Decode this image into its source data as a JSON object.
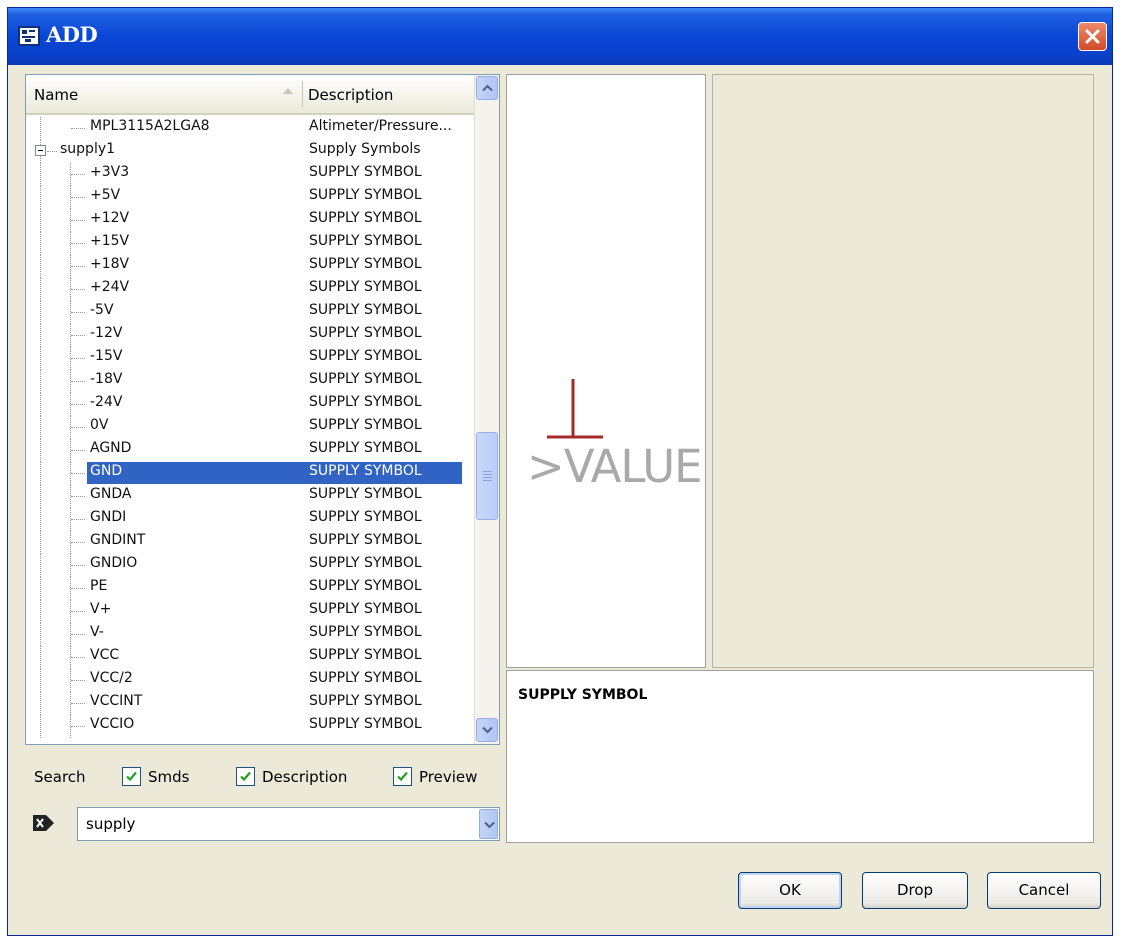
{
  "window": {
    "title": "ADD"
  },
  "tree": {
    "columns": {
      "name": "Name",
      "description": "Description"
    },
    "rows": [
      {
        "name": "MPL3115A2LGA8",
        "description": "Altimeter/Pressure...",
        "level": 2
      },
      {
        "name": "supply1",
        "description": "Supply Symbols",
        "level": 1,
        "expanded": true
      },
      {
        "name": "+3V3",
        "description": "SUPPLY SYMBOL",
        "level": 2
      },
      {
        "name": "+5V",
        "description": "SUPPLY SYMBOL",
        "level": 2
      },
      {
        "name": "+12V",
        "description": "SUPPLY SYMBOL",
        "level": 2
      },
      {
        "name": "+15V",
        "description": "SUPPLY SYMBOL",
        "level": 2
      },
      {
        "name": "+18V",
        "description": "SUPPLY SYMBOL",
        "level": 2
      },
      {
        "name": "+24V",
        "description": "SUPPLY SYMBOL",
        "level": 2
      },
      {
        "name": "-5V",
        "description": "SUPPLY SYMBOL",
        "level": 2
      },
      {
        "name": "-12V",
        "description": "SUPPLY SYMBOL",
        "level": 2
      },
      {
        "name": "-15V",
        "description": "SUPPLY SYMBOL",
        "level": 2
      },
      {
        "name": "-18V",
        "description": "SUPPLY SYMBOL",
        "level": 2
      },
      {
        "name": "-24V",
        "description": "SUPPLY SYMBOL",
        "level": 2
      },
      {
        "name": "0V",
        "description": "SUPPLY SYMBOL",
        "level": 2
      },
      {
        "name": "AGND",
        "description": "SUPPLY SYMBOL",
        "level": 2
      },
      {
        "name": "GND",
        "description": "SUPPLY SYMBOL",
        "level": 2,
        "selected": true
      },
      {
        "name": "GNDA",
        "description": "SUPPLY SYMBOL",
        "level": 2
      },
      {
        "name": "GNDI",
        "description": "SUPPLY SYMBOL",
        "level": 2
      },
      {
        "name": "GNDINT",
        "description": "SUPPLY SYMBOL",
        "level": 2
      },
      {
        "name": "GNDIO",
        "description": "SUPPLY SYMBOL",
        "level": 2
      },
      {
        "name": "PE",
        "description": "SUPPLY SYMBOL",
        "level": 2
      },
      {
        "name": "V+",
        "description": "SUPPLY SYMBOL",
        "level": 2
      },
      {
        "name": "V-",
        "description": "SUPPLY SYMBOL",
        "level": 2
      },
      {
        "name": "VCC",
        "description": "SUPPLY SYMBOL",
        "level": 2
      },
      {
        "name": "VCC/2",
        "description": "SUPPLY SYMBOL",
        "level": 2
      },
      {
        "name": "VCCINT",
        "description": "SUPPLY SYMBOL",
        "level": 2
      },
      {
        "name": "VCCIO",
        "description": "SUPPLY SYMBOL",
        "level": 2
      }
    ]
  },
  "search": {
    "label": "Search",
    "options": [
      {
        "label": "Smds",
        "checked": true
      },
      {
        "label": "Description",
        "checked": true
      },
      {
        "label": "Preview",
        "checked": true
      }
    ],
    "value": "supply"
  },
  "preview": {
    "symbol_value": ">VALUE",
    "symbol_color": "#a52a2a"
  },
  "details": {
    "description": "SUPPLY SYMBOL"
  },
  "buttons": {
    "ok": "OK",
    "drop": "Drop",
    "cancel": "Cancel"
  },
  "colors": {
    "selection": "#3163c5",
    "titlebar": "#0a46d6"
  }
}
